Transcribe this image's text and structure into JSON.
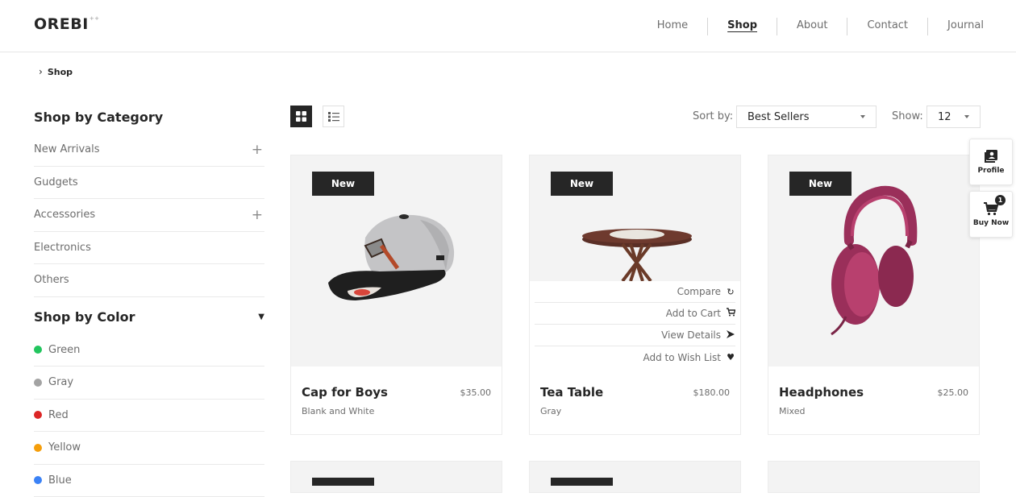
{
  "header": {
    "logo": "OREBI",
    "logo_mark": "++",
    "nav": [
      {
        "label": "Home"
      },
      {
        "label": "Shop"
      },
      {
        "label": "About"
      },
      {
        "label": "Contact"
      },
      {
        "label": "Journal"
      }
    ]
  },
  "breadcrumb": {
    "current": "Shop"
  },
  "sidebar": {
    "category_title": "Shop by Category",
    "categories": [
      {
        "label": "New Arrivals",
        "expandable": true
      },
      {
        "label": "Gudgets",
        "expandable": false
      },
      {
        "label": "Accessories",
        "expandable": true
      },
      {
        "label": "Electronics",
        "expandable": false
      },
      {
        "label": "Others",
        "expandable": false
      }
    ],
    "color_title": "Shop by Color",
    "colors": [
      {
        "label": "Green",
        "hex": "#22c55e"
      },
      {
        "label": "Gray",
        "hex": "#a3a3a3"
      },
      {
        "label": "Red",
        "hex": "#dc2626"
      },
      {
        "label": "Yellow",
        "hex": "#f59e0b"
      },
      {
        "label": "Blue",
        "hex": "#3b82f6"
      }
    ]
  },
  "toolbar": {
    "sort_label": "Sort by:",
    "sort_value": "Best Sellers",
    "show_label": "Show:",
    "show_value": "12"
  },
  "products": [
    {
      "badge": "New",
      "name": "Cap for Boys",
      "price": "$35.00",
      "color": "Blank and White"
    },
    {
      "badge": "New",
      "name": "Tea Table",
      "price": "$180.00",
      "color": "Gray"
    },
    {
      "badge": "New",
      "name": "Headphones",
      "price": "$25.00",
      "color": "Mixed"
    }
  ],
  "hover_actions": [
    {
      "label": "Compare",
      "icon": "refresh-icon"
    },
    {
      "label": "Add to Cart",
      "icon": "cart-icon"
    },
    {
      "label": "View Details",
      "icon": "arrow-right-icon"
    },
    {
      "label": "Add to Wish List",
      "icon": "heart-icon"
    }
  ],
  "floating": {
    "profile_label": "Profile",
    "buy_label": "Buy Now",
    "cart_count": "1"
  }
}
